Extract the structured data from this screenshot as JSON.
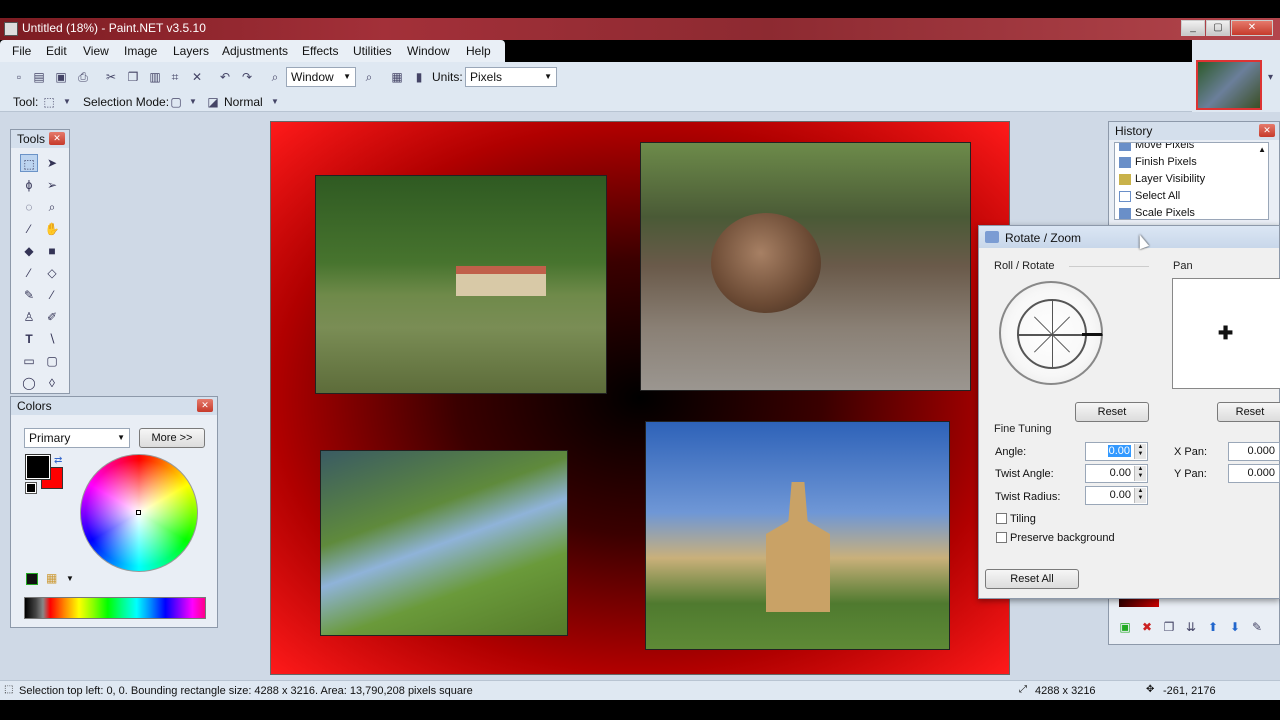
{
  "window": {
    "title": "Untitled (18%) - Paint.NET v3.5.10"
  },
  "menu": [
    "File",
    "Edit",
    "View",
    "Image",
    "Layers",
    "Adjustments",
    "Effects",
    "Utilities",
    "Window",
    "Help"
  ],
  "toolbar": {
    "zoom_value": "Window",
    "units_label": "Units:",
    "units_value": "Pixels",
    "tool_label": "Tool:",
    "selection_mode_label": "Selection Mode:",
    "blend_mode": "Normal"
  },
  "tools_panel": {
    "title": "Tools"
  },
  "colors_panel": {
    "title": "Colors",
    "mode": "Primary",
    "more_label": "More >>",
    "primary_color": "#000000",
    "secondary_color": "#ff0000"
  },
  "history_panel": {
    "title": "History",
    "items": [
      "Move Pixels",
      "Finish Pixels",
      "Layer Visibility",
      "Select All",
      "Scale Pixels"
    ]
  },
  "dialog": {
    "title": "Rotate / Zoom",
    "roll_rotate_label": "Roll / Rotate",
    "pan_label": "Pan",
    "reset_label": "Reset",
    "reset_pan_label": "Reset",
    "fine_tuning_label": "Fine Tuning",
    "angle_label": "Angle:",
    "angle_value": "0.00",
    "twist_angle_label": "Twist Angle:",
    "twist_angle_value": "0.00",
    "twist_radius_label": "Twist Radius:",
    "twist_radius_value": "0.00",
    "xpan_label": "X Pan:",
    "xpan_value": "0.000",
    "ypan_label": "Y Pan:",
    "ypan_value": "0.000",
    "tiling_label": "Tiling",
    "preserve_label": "Preserve background",
    "reset_all_label": "Reset All"
  },
  "status": {
    "selection_text": "Selection top left: 0, 0. Bounding rectangle size: 4288 x 3216. Area: 13,790,208 pixels square",
    "image_size": "4288 x 3216",
    "cursor_pos": "-261, 2176"
  }
}
